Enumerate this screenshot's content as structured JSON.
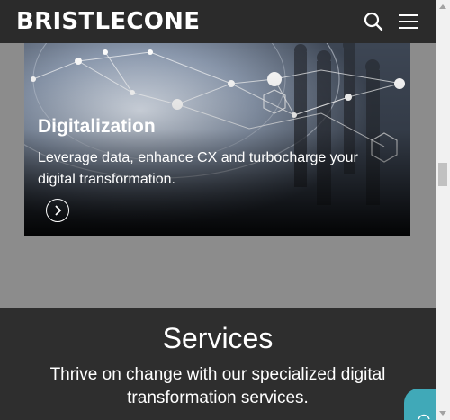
{
  "header": {
    "logo": "BRISTLECONE",
    "search_icon": "search-icon",
    "menu_icon": "hamburger-menu-icon"
  },
  "card": {
    "title": "Digitalization",
    "description": "Leverage data, enhance CX and turbocharge your digital transformation.",
    "arrow_icon": "chevron-right-icon"
  },
  "services": {
    "title": "Services",
    "subtitle": "Thrive on change with our specialized digital transformation services."
  },
  "colors": {
    "header_bg": "#2b2b2b",
    "page_bg": "#8c8c8c",
    "services_bg": "#2e2e2e",
    "chat_accent": "#40a9b8"
  }
}
